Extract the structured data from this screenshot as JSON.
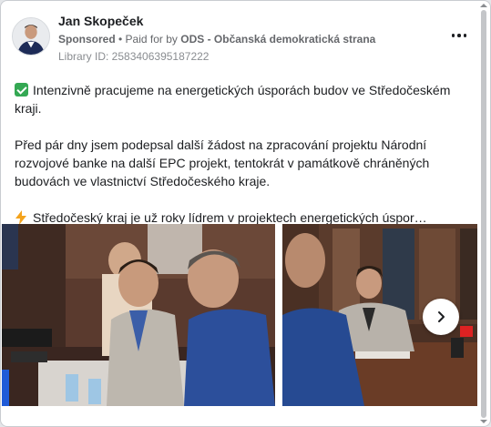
{
  "post": {
    "author": "Jan Skopeček",
    "sponsored_label": "Sponsored",
    "paid_for_prefix": " • Paid for by ",
    "payer": "ODS - Občanská demokratická strana",
    "library_id": "Library ID: 2583406395187222",
    "paragraph_1": "Intenzivně pracujeme na energetických úsporách budov ve Středočeském kraji.",
    "paragraph_2": "Před pár dny jsem podepsal další žádost na zpracování projektu Národní rozvojové banke na další EPC projekt, tentokrát v památkově chráněných budovách ve vlastnictví Středočeského kraje.",
    "paragraph_3": "Středočeský kraj je už roky lídrem v projektech energetických úspor…"
  },
  "icons": {
    "paragraph_1": "check-mark-emoji-icon",
    "paragraph_3": "lightning-bolt-emoji-icon",
    "more": "more-options-icon",
    "next": "chevron-right-icon"
  },
  "colors": {
    "accent_check": "#34a853",
    "bolt": "#f4a31c",
    "text_primary": "#1c1e21",
    "text_secondary": "#65676b"
  }
}
